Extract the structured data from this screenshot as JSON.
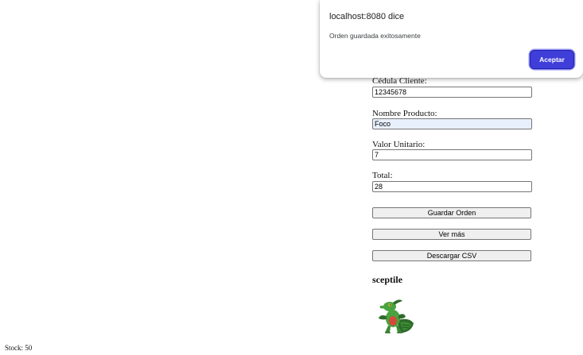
{
  "form": {
    "cedula": {
      "label": "Cédula Cliente:",
      "value": "12345678"
    },
    "producto": {
      "label": "Nombre Producto:",
      "value": "Foco"
    },
    "valor": {
      "label": "Valor Unitario:",
      "value": "7"
    },
    "total": {
      "label": "Total:",
      "value": "28"
    }
  },
  "buttons": {
    "guardar": "Guardar Orden",
    "ver_mas": "Ver más",
    "descargar": "Descargar CSV"
  },
  "product": {
    "name": "sceptile",
    "image_icon": "sceptile-sprite"
  },
  "stock": "Stock: 50",
  "dialog": {
    "title": "localhost:8080 dice",
    "message": "Orden guardada exitosamente",
    "ok_label": "Aceptar",
    "accent_color": "#3f3ed9"
  }
}
